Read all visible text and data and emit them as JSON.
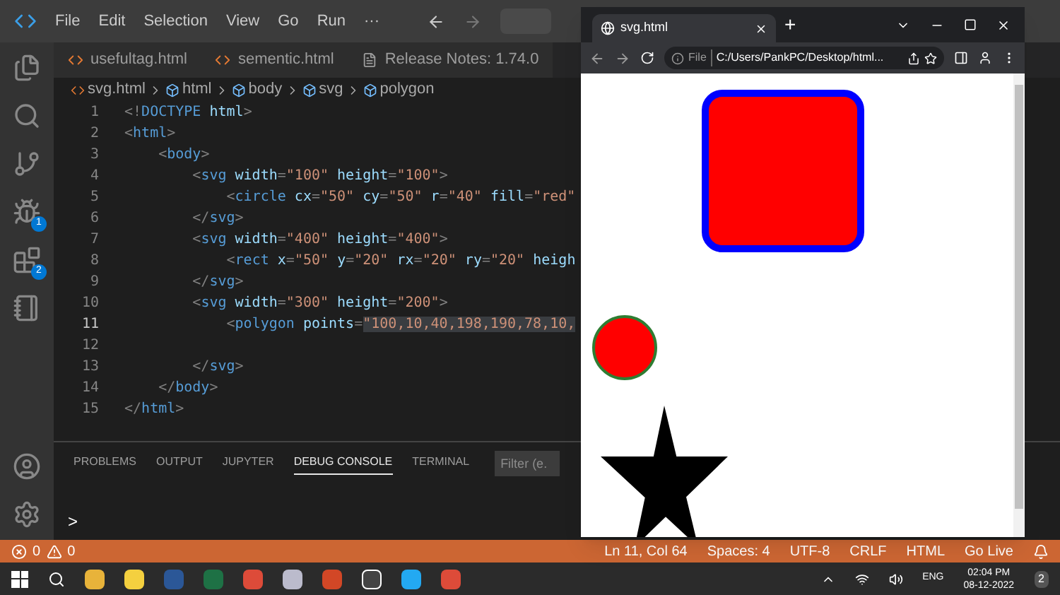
{
  "menu": [
    "File",
    "Edit",
    "Selection",
    "View",
    "Go",
    "Run",
    "···"
  ],
  "activity_badges": [
    {
      "kind": "debug",
      "badge": "1"
    },
    {
      "kind": "extensions",
      "badge": "2"
    }
  ],
  "tabs": [
    {
      "label": "usefultag.html",
      "kind": "html",
      "selected": false
    },
    {
      "label": "sementic.html",
      "kind": "html",
      "selected": false
    },
    {
      "label": "Release Notes: 1.74.0",
      "kind": "notes",
      "selected": false
    }
  ],
  "breadcrumb": [
    "svg.html",
    "html",
    "body",
    "svg",
    "polygon"
  ],
  "code": {
    "lines": [
      {
        "num": "1",
        "tokens": [
          {
            "kind": "p",
            "text": "<!"
          },
          {
            "kind": "tag",
            "text": "DOCTYPE"
          },
          {
            "kind": "attr",
            "text": " html"
          },
          {
            "kind": "p",
            "text": ">"
          }
        ]
      },
      {
        "num": "2",
        "tokens": [
          {
            "kind": "p",
            "text": "<"
          },
          {
            "kind": "tag",
            "text": "html"
          },
          {
            "kind": "p",
            "text": ">"
          }
        ]
      },
      {
        "num": "3",
        "tokens": [
          {
            "kind": "p",
            "text": "    <"
          },
          {
            "kind": "tag",
            "text": "body"
          },
          {
            "kind": "p",
            "text": ">"
          }
        ]
      },
      {
        "num": "4",
        "tokens": [
          {
            "kind": "p",
            "text": "        <"
          },
          {
            "kind": "tag",
            "text": "svg"
          },
          {
            "kind": "attr",
            "text": " width"
          },
          {
            "kind": "p",
            "text": "="
          },
          {
            "kind": "str",
            "text": "\"100\""
          },
          {
            "kind": "attr",
            "text": " height"
          },
          {
            "kind": "p",
            "text": "="
          },
          {
            "kind": "str",
            "text": "\"100\""
          },
          {
            "kind": "p",
            "text": ">"
          }
        ]
      },
      {
        "num": "5",
        "tokens": [
          {
            "kind": "p",
            "text": "            <"
          },
          {
            "kind": "tag",
            "text": "circle"
          },
          {
            "kind": "attr",
            "text": " cx"
          },
          {
            "kind": "p",
            "text": "="
          },
          {
            "kind": "str",
            "text": "\"50\""
          },
          {
            "kind": "attr",
            "text": " cy"
          },
          {
            "kind": "p",
            "text": "="
          },
          {
            "kind": "str",
            "text": "\"50\""
          },
          {
            "kind": "attr",
            "text": " r"
          },
          {
            "kind": "p",
            "text": "="
          },
          {
            "kind": "str",
            "text": "\"40\""
          },
          {
            "kind": "attr",
            "text": " fill"
          },
          {
            "kind": "p",
            "text": "="
          },
          {
            "kind": "str",
            "text": "\"red\""
          }
        ]
      },
      {
        "num": "6",
        "tokens": [
          {
            "kind": "p",
            "text": "        </"
          },
          {
            "kind": "tag",
            "text": "svg"
          },
          {
            "kind": "p",
            "text": ">"
          }
        ]
      },
      {
        "num": "7",
        "tokens": [
          {
            "kind": "p",
            "text": "        <"
          },
          {
            "kind": "tag",
            "text": "svg"
          },
          {
            "kind": "attr",
            "text": " width"
          },
          {
            "kind": "p",
            "text": "="
          },
          {
            "kind": "str",
            "text": "\"400\""
          },
          {
            "kind": "attr",
            "text": " height"
          },
          {
            "kind": "p",
            "text": "="
          },
          {
            "kind": "str",
            "text": "\"400\""
          },
          {
            "kind": "p",
            "text": ">"
          }
        ]
      },
      {
        "num": "8",
        "tokens": [
          {
            "kind": "p",
            "text": "            <"
          },
          {
            "kind": "tag",
            "text": "rect"
          },
          {
            "kind": "attr",
            "text": " x"
          },
          {
            "kind": "p",
            "text": "="
          },
          {
            "kind": "str",
            "text": "\"50\""
          },
          {
            "kind": "attr",
            "text": " y"
          },
          {
            "kind": "p",
            "text": "="
          },
          {
            "kind": "str",
            "text": "\"20\""
          },
          {
            "kind": "attr",
            "text": " rx"
          },
          {
            "kind": "p",
            "text": "="
          },
          {
            "kind": "str",
            "text": "\"20\""
          },
          {
            "kind": "attr",
            "text": " ry"
          },
          {
            "kind": "p",
            "text": "="
          },
          {
            "kind": "str",
            "text": "\"20\""
          },
          {
            "kind": "attr",
            "text": " heigh"
          }
        ]
      },
      {
        "num": "9",
        "tokens": [
          {
            "kind": "p",
            "text": "        </"
          },
          {
            "kind": "tag",
            "text": "svg"
          },
          {
            "kind": "p",
            "text": ">"
          }
        ]
      },
      {
        "num": "10",
        "tokens": [
          {
            "kind": "p",
            "text": "        <"
          },
          {
            "kind": "tag",
            "text": "svg"
          },
          {
            "kind": "attr",
            "text": " width"
          },
          {
            "kind": "p",
            "text": "="
          },
          {
            "kind": "str",
            "text": "\"300\""
          },
          {
            "kind": "attr",
            "text": " height"
          },
          {
            "kind": "p",
            "text": "="
          },
          {
            "kind": "str",
            "text": "\"200\""
          },
          {
            "kind": "p",
            "text": ">"
          }
        ]
      },
      {
        "num": "11",
        "active": true,
        "tokens": [
          {
            "kind": "p",
            "text": "            <"
          },
          {
            "kind": "tag",
            "text": "polygon"
          },
          {
            "kind": "attr",
            "text": " points"
          },
          {
            "kind": "p",
            "text": "="
          },
          {
            "kind": "strhl",
            "text": "\"100,10,40,198,190,78,10,"
          }
        ]
      },
      {
        "num": "12",
        "active": false
      },
      {
        "num": "13",
        "tokens": [
          {
            "kind": "p",
            "text": "        </"
          },
          {
            "kind": "tag",
            "text": "svg"
          },
          {
            "kind": "p",
            "text": ">"
          }
        ]
      },
      {
        "num": "14",
        "tokens": [
          {
            "kind": "p",
            "text": "    </"
          },
          {
            "kind": "tag",
            "text": "body"
          },
          {
            "kind": "p",
            "text": ">"
          }
        ]
      },
      {
        "num": "15",
        "tokens": [
          {
            "kind": "p",
            "text": "</"
          },
          {
            "kind": "tag",
            "text": "html"
          },
          {
            "kind": "p",
            "text": ">"
          }
        ]
      }
    ]
  },
  "panel": {
    "tabs": [
      {
        "label": "PROBLEMS",
        "selected": false
      },
      {
        "label": "OUTPUT",
        "selected": false
      },
      {
        "label": "JUPYTER",
        "selected": false
      },
      {
        "label": "DEBUG CONSOLE",
        "selected": true
      },
      {
        "label": "TERMINAL",
        "selected": false
      }
    ],
    "filter_placeholder": "Filter (e.",
    "prompt": ">"
  },
  "status_bar": {
    "errors": "0",
    "warnings": "0",
    "right": [
      "Ln 11, Col 64",
      "Spaces: 4",
      "UTF-8",
      "CRLF",
      "HTML",
      "Go Live"
    ]
  },
  "browser": {
    "tab_title": "svg.html",
    "new_tab": "+",
    "scheme": "File",
    "url": "C:/Users/PankPC/Desktop/html..."
  },
  "taskbar": {
    "language": "ENG",
    "time": "02:04 PM",
    "date": "08-12-2022",
    "notification_count": "2"
  }
}
